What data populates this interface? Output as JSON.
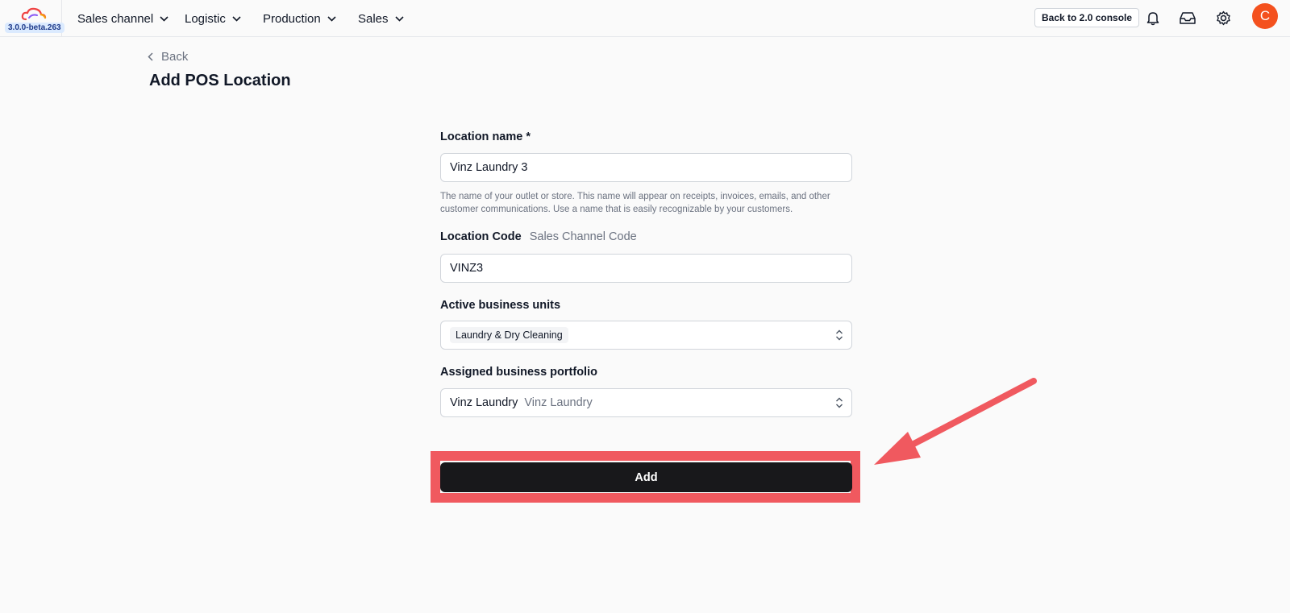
{
  "app": {
    "version": "3.0.0-beta.263"
  },
  "nav": {
    "items": [
      {
        "label": "Sales channel"
      },
      {
        "label": "Logistic"
      },
      {
        "label": "Production"
      },
      {
        "label": "Sales"
      }
    ]
  },
  "header": {
    "console_button": "Back to 2.0 console",
    "avatar_initial": "C"
  },
  "page": {
    "back_label": "Back",
    "title": "Add POS Location"
  },
  "form": {
    "location_name": {
      "label": "Location name *",
      "value": "Vinz Laundry 3",
      "help": "The name of your outlet or store. This name will appear on receipts, invoices, emails, and other customer communications. Use a name that is easily recognizable by your customers."
    },
    "location_code": {
      "label": "Location Code",
      "sub_label": "Sales Channel Code",
      "value": "VINZ3"
    },
    "business_units": {
      "label": "Active business units",
      "selected": "Laundry & Dry Cleaning"
    },
    "portfolio": {
      "label": "Assigned business portfolio",
      "value": "Vinz Laundry",
      "secondary": "Vinz Laundry"
    },
    "submit_label": "Add"
  },
  "annotation": {
    "highlight_color": "#f0595f"
  },
  "icons": [
    "cloud-logo-icon",
    "chevron-down-icon",
    "chevron-left-icon",
    "bell-icon",
    "inbox-icon",
    "gear-icon",
    "chevron-up-down-icon",
    "arrow-annotation-icon"
  ]
}
